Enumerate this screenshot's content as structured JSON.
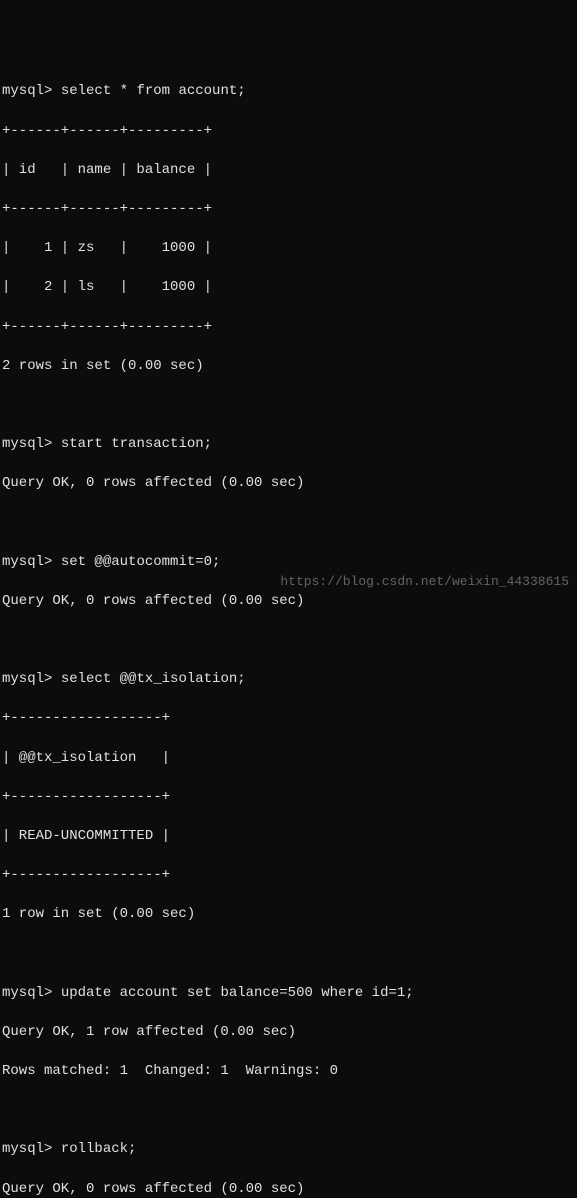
{
  "prompt": "mysql>",
  "queries": {
    "q1": "select * from account;",
    "q2": "start transaction;",
    "q3": "set @@autocommit=0;",
    "q4": "select @@tx_isolation;",
    "q5": "update account set balance=500 where id=1;",
    "q6": "rollback;"
  },
  "table1": {
    "border_top": "+------+------+---------+",
    "header": "| id   | name | balance |",
    "border_mid": "+------+------+---------+",
    "row1": "|    1 | zs   |    1000 |",
    "row2": "|    2 | ls   |    1000 |",
    "border_bot": "+------+------+---------+",
    "footer": "2 rows in set (0.00 sec)"
  },
  "resp_ok_0": "Query OK, 0 rows affected (0.00 sec)",
  "table2": {
    "border_top": "+------------------+",
    "header": "| @@tx_isolation   |",
    "border_mid": "+------------------+",
    "row1": "| READ-UNCOMMITTED |",
    "border_bot": "+------------------+",
    "footer": "1 row in set (0.00 sec)"
  },
  "update_result": {
    "line1": "Query OK, 1 row affected (0.00 sec)",
    "line2": "Rows matched: 1  Changed: 1  Warnings: 0"
  },
  "rollback_result": "Query OK, 0 rows affected (0.00 sec)",
  "watermark": "https://blog.csdn.net/weixin_44338615"
}
